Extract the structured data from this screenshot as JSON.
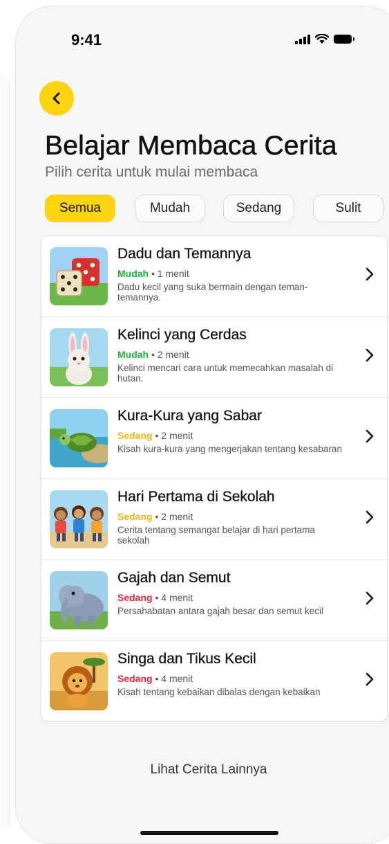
{
  "status_bar": {
    "time": "9:41",
    "icons": [
      "signal-icon",
      "wifi-icon",
      "battery-icon"
    ]
  },
  "header": {
    "back_icon": "chevron-left-icon",
    "title": "Belajar Membaca Cerita",
    "subtitle": "Pilih cerita untuk mulai membaca"
  },
  "filters": [
    {
      "label": "Semua",
      "active": true
    },
    {
      "label": "Mudah",
      "active": false
    },
    {
      "label": "Sedang",
      "active": false
    },
    {
      "label": "Sulit",
      "active": false
    }
  ],
  "separator": "•",
  "stories": [
    {
      "title": "Dadu dan Temannya",
      "level": "Mudah",
      "level_color": "#1fb13d",
      "duration": "1 menit",
      "description": "Dadu kecil yang suka bermain dengan teman-temannya.",
      "thumbnail": "dice-illustration"
    },
    {
      "title": "Kelinci yang Cerdas",
      "level": "Mudah",
      "level_color": "#1fb13d",
      "duration": "2 menit",
      "description": "Kelinci mencari cara untuk memecahkan masalah di hutan.",
      "thumbnail": "rabbit-illustration"
    },
    {
      "title": "Kura-Kura yang Sabar",
      "level": "Sedang",
      "level_color": "#f2b705",
      "duration": "2 menit",
      "description": "Kisah kura-kura yang mengerjakan tentang kesabaran",
      "thumbnail": "turtle-illustration"
    },
    {
      "title": "Hari Pertama di Sekolah",
      "level": "Sedang",
      "level_color": "#f2b705",
      "duration": "2 menit",
      "description": "Cerita tentang semangat belajar di hari pertama sekolah",
      "thumbnail": "kids-illustration"
    },
    {
      "title": "Gajah dan Semut",
      "level": "Sedang",
      "level_color": "#e8283a",
      "duration": "4 menit",
      "description": "Persahabatan antara gajah besar dan semut kecil",
      "thumbnail": "elephant-illustration"
    },
    {
      "title": "Singa dan Tikus Kecil",
      "level": "Sedang",
      "level_color": "#e8283a",
      "duration": "4 menit",
      "description": "Kisah tentang kebaikan dibalas dengan kebaikan",
      "thumbnail": "lion-illustration"
    }
  ],
  "footer": {
    "more_label": "Lihat Cerita Lainnya"
  },
  "colors": {
    "accent": "#fcd40f",
    "background": "#f6f6f6"
  }
}
